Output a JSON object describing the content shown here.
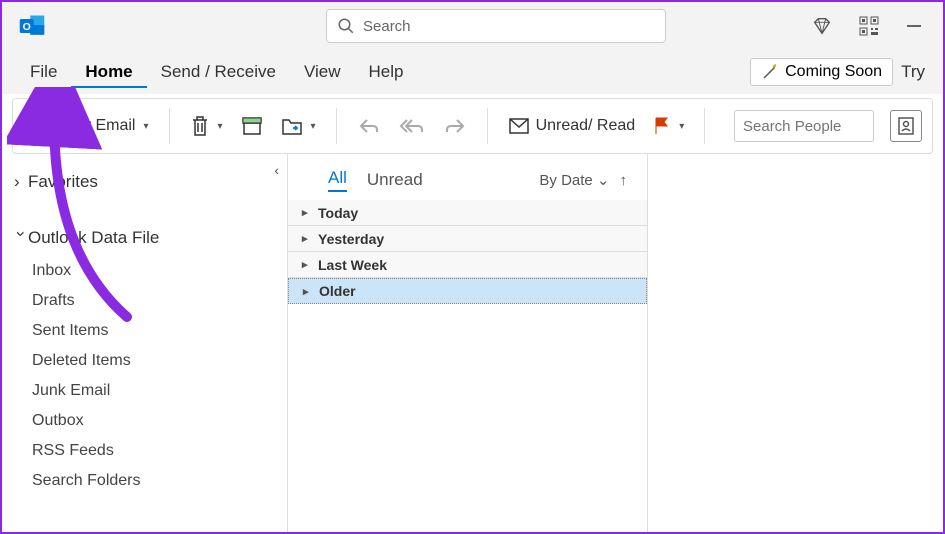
{
  "titlebar": {
    "search_placeholder": "Search"
  },
  "menu": {
    "file": "File",
    "home": "Home",
    "send_receive": "Send / Receive",
    "view": "View",
    "help": "Help",
    "coming_soon": "Coming Soon",
    "try": "Try"
  },
  "ribbon": {
    "new_email": "New Email",
    "unread_read": "Unread/ Read",
    "search_people_placeholder": "Search People"
  },
  "sidebar": {
    "favorites": "Favorites",
    "data_file": "Outlook Data File",
    "folders": [
      "Inbox",
      "Drafts",
      "Sent Items",
      "Deleted Items",
      "Junk Email",
      "Outbox",
      "RSS Feeds",
      "Search Folders"
    ]
  },
  "list": {
    "tab_all": "All",
    "tab_unread": "Unread",
    "sort_by": "By Date",
    "groups": [
      "Today",
      "Yesterday",
      "Last Week",
      "Older"
    ]
  }
}
